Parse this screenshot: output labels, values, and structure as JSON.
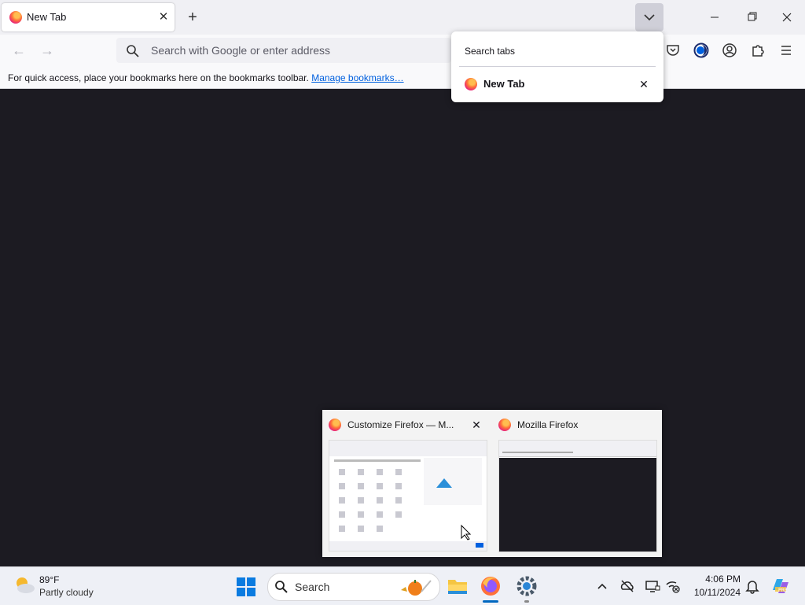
{
  "browser": {
    "tab": {
      "title": "New Tab",
      "close_icon": "close-icon"
    },
    "new_tab_icon": "plus-icon",
    "list_all_tabs_icon": "chevron-down-icon",
    "window_controls": [
      "minimize-icon",
      "restore-icon",
      "close-icon"
    ],
    "urlbar": {
      "placeholder": "Search with Google or enter address"
    },
    "toolbar_icons": [
      "pocket-icon",
      "firefox-view-icon",
      "account-icon",
      "extensions-icon",
      "menu-icon"
    ],
    "bookmarks_bar": {
      "text": "For quick access, place your bookmarks here on the bookmarks toolbar.",
      "link": "Manage bookmarks…"
    }
  },
  "tabs_panel": {
    "search_label": "Search tabs",
    "items": [
      {
        "title": "New Tab"
      }
    ]
  },
  "thumbnails": [
    {
      "title": "Customize Firefox — M..."
    },
    {
      "title": "Mozilla Firefox"
    }
  ],
  "taskbar": {
    "weather": {
      "temp": "89°F",
      "desc": "Partly cloudy"
    },
    "search_label": "Search",
    "clock": {
      "time": "4:06 PM",
      "date": "10/11/2024"
    },
    "apps": [
      "file-explorer-icon",
      "firefox-icon",
      "settings-icon"
    ],
    "tray_icons": [
      "chevron-up-icon",
      "onedrive-icon",
      "display-icon",
      "network-icon"
    ]
  },
  "colors": {
    "accent": "#0060df",
    "content_bg": "#1c1b22",
    "taskbar_bg": "#eef0f6"
  }
}
